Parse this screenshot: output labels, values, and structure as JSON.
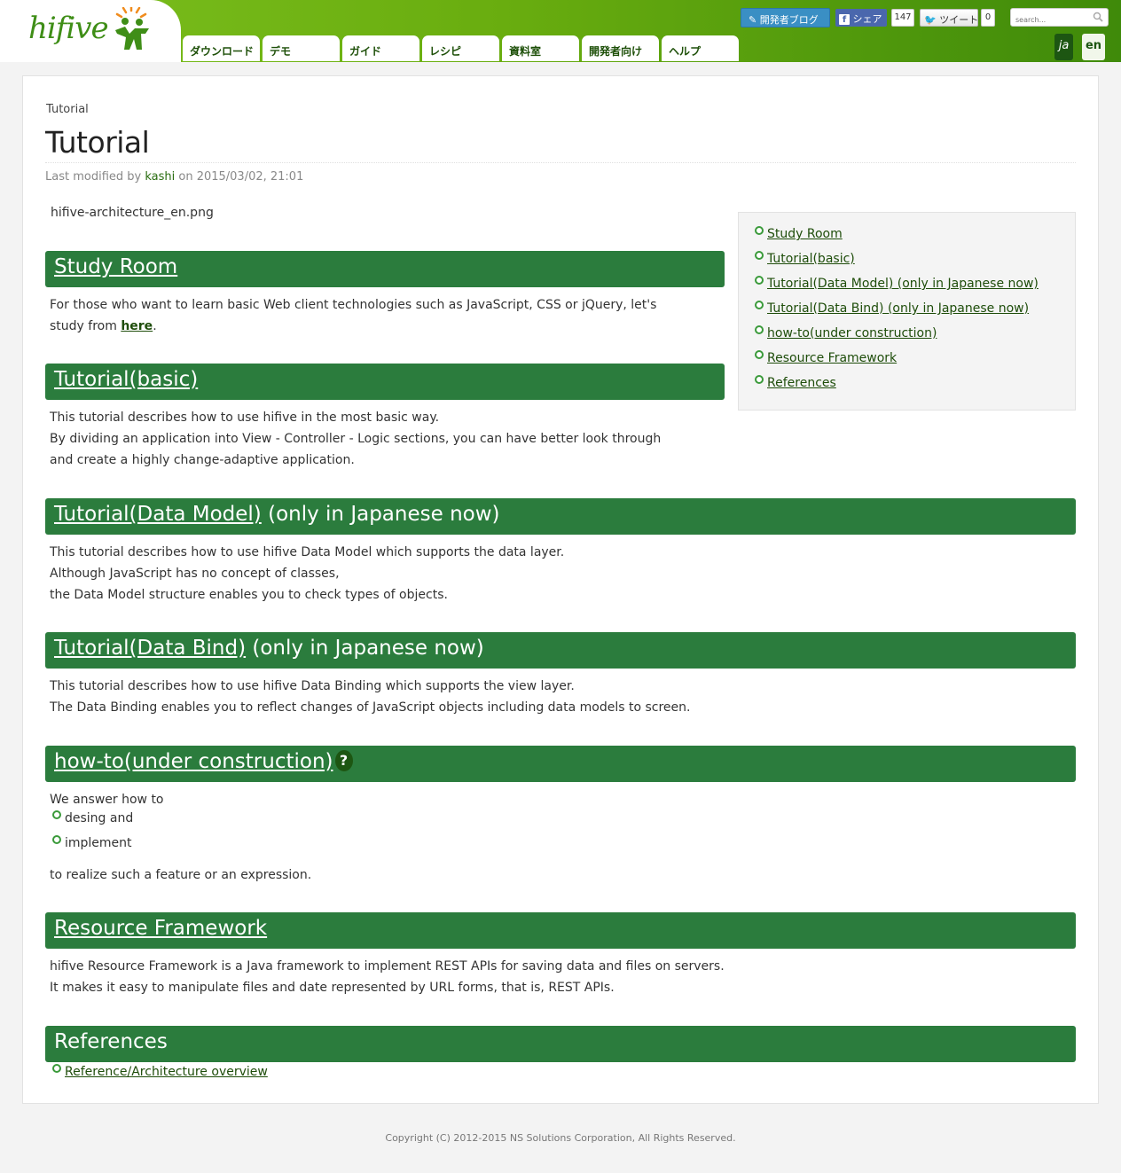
{
  "header": {
    "logo_text": "hifive",
    "nav": [
      "ダウンロード",
      "デモ",
      "ガイド",
      "レシピ",
      "資料室",
      "開発者向け",
      "ヘルプ"
    ],
    "blog_label": "開発者ブログ",
    "share_label": "シェア",
    "share_count": "147",
    "tweet_label": "ツイート",
    "tweet_count": "0",
    "search_placeholder": "search...",
    "lang_ja": "ja",
    "lang_en": "en"
  },
  "page": {
    "breadcrumb": "Tutorial",
    "title": "Tutorial",
    "meta_prefix": "Last modified by ",
    "author": "kashi",
    "meta_suffix": " on 2015/03/02, 21:01",
    "image_alt": "hifive-architecture_en.png"
  },
  "toc": [
    "Study Room",
    "Tutorial(basic)",
    "Tutorial(Data Model) (only in Japanese now)",
    "Tutorial(Data Bind) (only in Japanese now)",
    "how-to(under construction)",
    "Resource Framework",
    "References"
  ],
  "sections": {
    "study": {
      "title": "Study Room",
      "line1": "For those who want to learn basic Web client technologies such as JavaScript, CSS or jQuery, let's",
      "line2_prefix": "study from ",
      "line2_link": "here",
      "line2_suffix": "."
    },
    "basic": {
      "title": "Tutorial(basic)",
      "lines": [
        "This tutorial describes how to use hifive in the most basic way.",
        "By dividing an application into View - Controller - Logic sections, you can have better look through",
        "and create a highly change-adaptive application."
      ]
    },
    "model": {
      "title_link": "Tutorial(Data Model)",
      "title_suffix": " (only in Japanese now)",
      "lines": [
        "This tutorial describes how to use hifive Data Model which supports the data layer.",
        "Although JavaScript has no concept of classes,",
        "the Data Model structure enables you to check types of objects."
      ]
    },
    "bind": {
      "title_link": "Tutorial(Data Bind)",
      "title_suffix": " (only in Japanese now)",
      "lines": [
        "This tutorial describes how to use hifive Data Binding which supports the view layer.",
        "The Data Binding enables you to reflect changes of JavaScript objects including data models to screen."
      ]
    },
    "howto": {
      "title": "how-to(under construction)",
      "badge": "?",
      "intro": "We answer how to",
      "items": [
        "desing and",
        "implement"
      ],
      "outro": "to realize such a feature or an expression."
    },
    "resource": {
      "title": "Resource Framework",
      "lines": [
        "hifive Resource Framework is a Java framework to implement REST APIs for saving data and files on servers.",
        "It makes it easy to manipulate files and date represented by URL forms, that is, REST APIs."
      ]
    },
    "references": {
      "title": "References",
      "link": "Reference/Architecture overview"
    }
  },
  "footer": "Copyright (C) 2012-2015 NS Solutions Corporation, All Rights Reserved.",
  "colors": {
    "header_green": "#69ad0f",
    "section_green": "#2b7c3d",
    "link_green": "#1e4d0a"
  }
}
